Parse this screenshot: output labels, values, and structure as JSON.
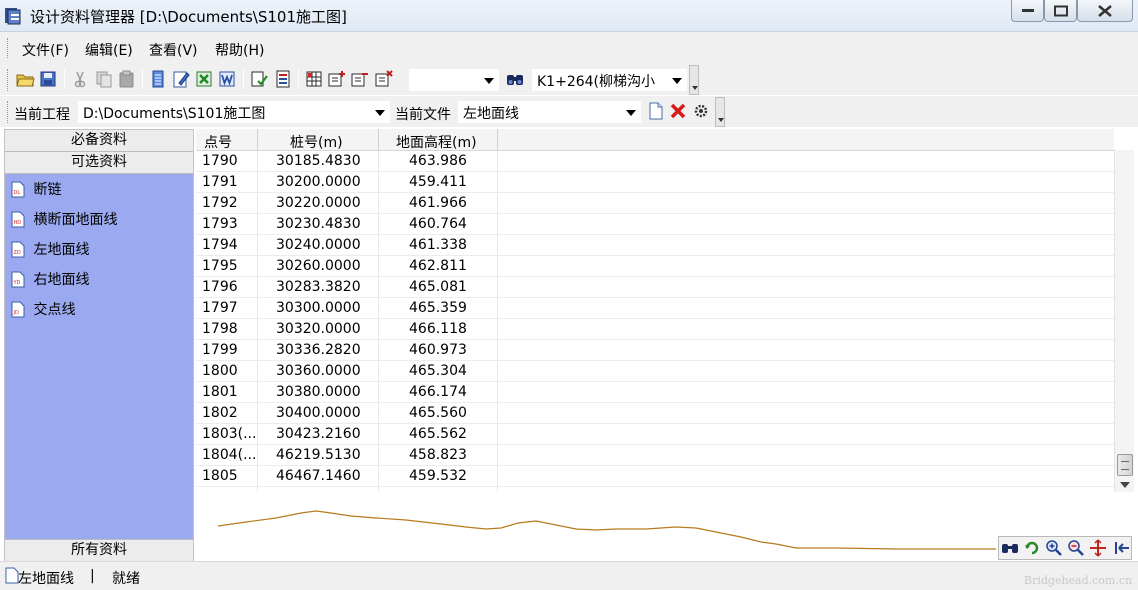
{
  "window": {
    "title": "设计资料管理器  [D:\\Documents\\S101施工图]"
  },
  "menu": {
    "items": [
      {
        "label": "文件(F)"
      },
      {
        "label": "编辑(E)"
      },
      {
        "label": "查看(V)"
      },
      {
        "label": "帮助(H)"
      }
    ]
  },
  "toolbar1": {
    "station_value": "K1+264(柳梯沟小\u000b",
    "blank_combo_value": ""
  },
  "toolbar2": {
    "project_label": "当前工程",
    "project_value": "D:\\Documents\\S101施工图",
    "file_label": "当前文件",
    "file_value": "左地面线"
  },
  "left_panel": {
    "header_required": "必备资料",
    "header_optional": "可选资料",
    "footer_all": "所有资料",
    "items": [
      {
        "label": "断链",
        "badge": "DL"
      },
      {
        "label": "横断面地面线",
        "badge": "HD"
      },
      {
        "label": "左地面线",
        "badge": "ZD"
      },
      {
        "label": "右地面线",
        "badge": "YD"
      },
      {
        "label": "交点线",
        "badge": "JD"
      }
    ]
  },
  "table": {
    "columns": [
      "点号",
      "桩号(m)",
      "地面高程(m)"
    ],
    "rows": [
      [
        "1790",
        "30185.4830",
        "463.986"
      ],
      [
        "1791",
        "30200.0000",
        "459.411"
      ],
      [
        "1792",
        "30220.0000",
        "461.966"
      ],
      [
        "1793",
        "30230.4830",
        "460.764"
      ],
      [
        "1794",
        "30240.0000",
        "461.338"
      ],
      [
        "1795",
        "30260.0000",
        "462.811"
      ],
      [
        "1796",
        "30283.3820",
        "465.081"
      ],
      [
        "1797",
        "30300.0000",
        "465.359"
      ],
      [
        "1798",
        "30320.0000",
        "466.118"
      ],
      [
        "1799",
        "30336.2820",
        "460.973"
      ],
      [
        "1800",
        "30360.0000",
        "465.304"
      ],
      [
        "1801",
        "30380.0000",
        "466.174"
      ],
      [
        "1802",
        "30400.0000",
        "465.560"
      ],
      [
        "1803(...",
        "30423.2160",
        "465.562"
      ],
      [
        "1804(...",
        "46219.5130",
        "458.823"
      ],
      [
        "1805",
        "46467.1460",
        "459.532"
      ]
    ]
  },
  "status": {
    "current_file": "左地面线",
    "separator": "|",
    "state": "就绪"
  },
  "watermark": "Bridgehead.com.cn",
  "colors": {
    "left_panel_bg": "#9aa9f0",
    "profile_line": "#b87a1e"
  }
}
